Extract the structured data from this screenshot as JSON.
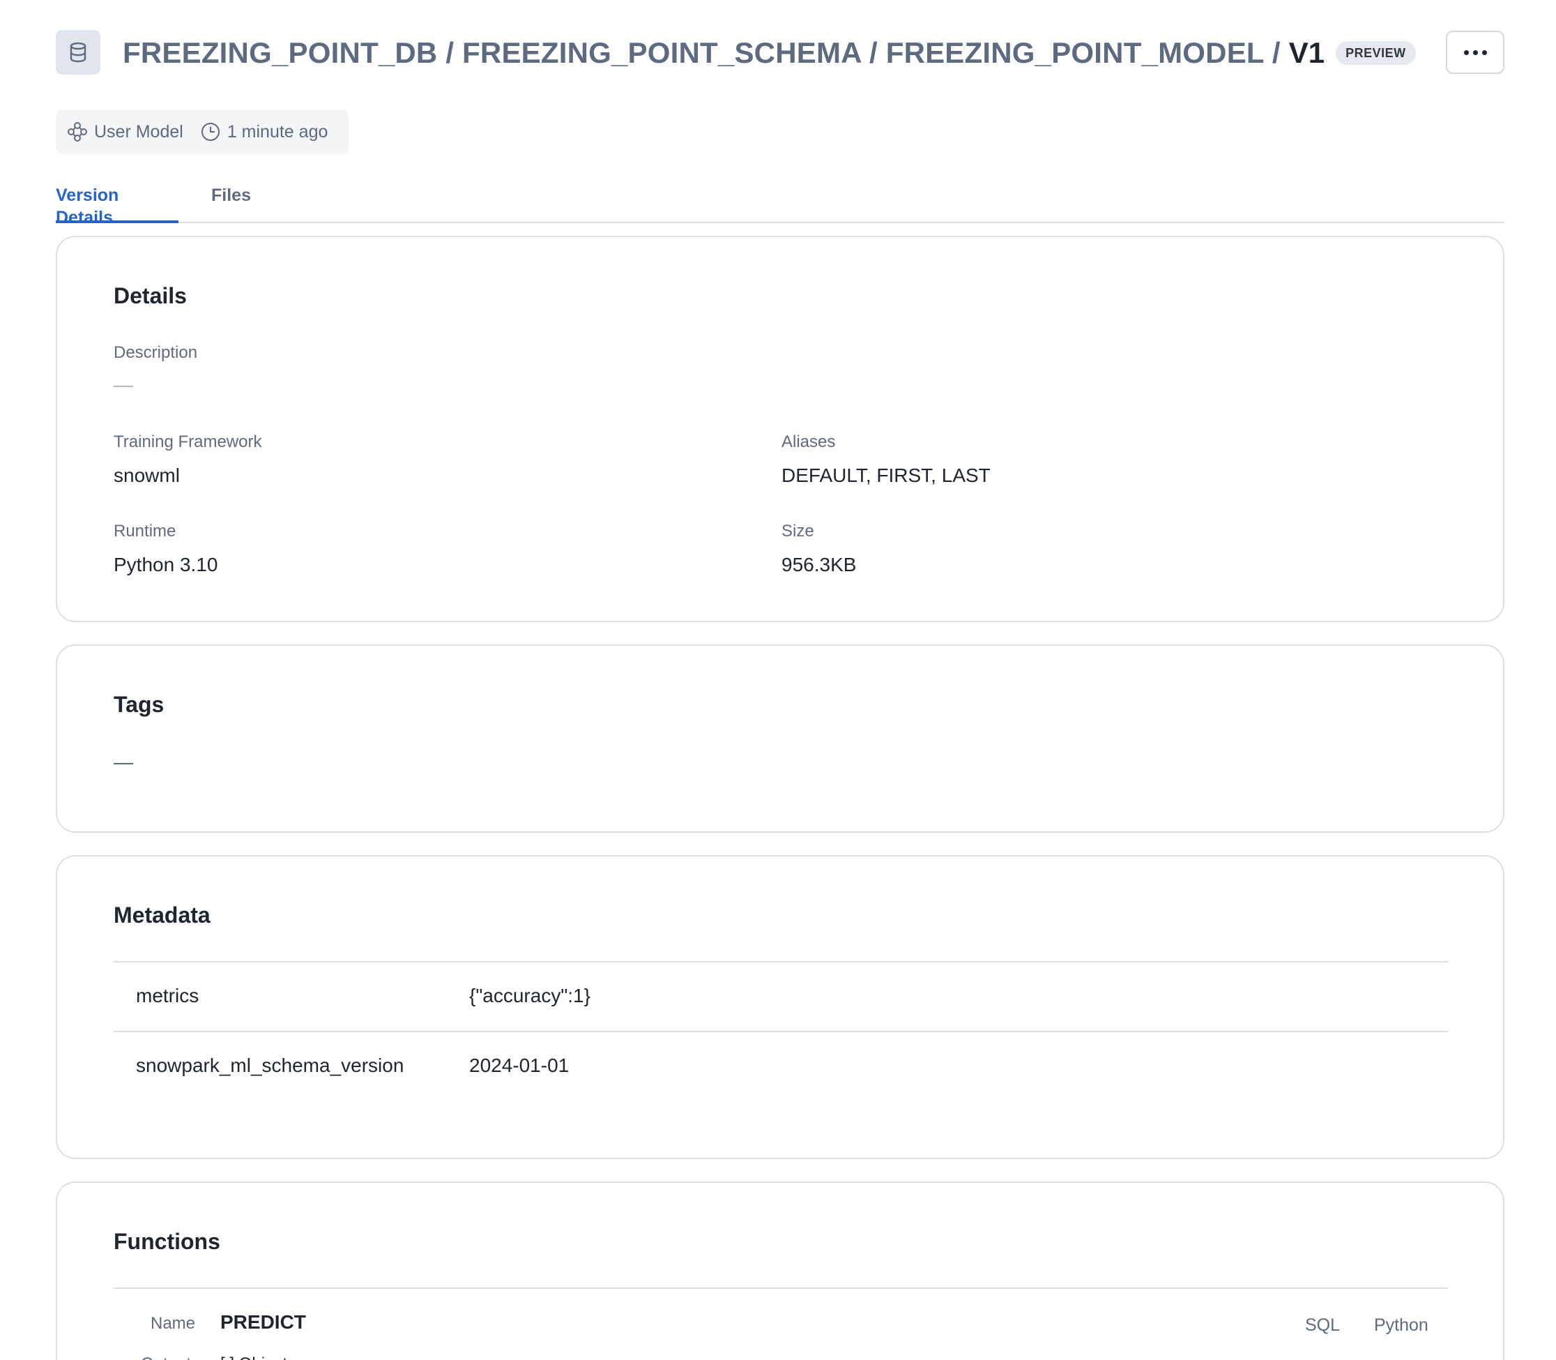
{
  "header": {
    "icon": "database-icon",
    "path": "FREEZING_POINT_DB / FREEZING_POINT_SCHEMA / FREEZING_POINT_MODEL /",
    "version": "V1",
    "badge": "PREVIEW",
    "more_icon": "more-horizontal-icon"
  },
  "meta_chip": {
    "model_type": "User Model",
    "model_type_icon": "model-graph-icon",
    "updated": "1 minute ago",
    "updated_icon": "clock-icon"
  },
  "tabs": [
    {
      "label": "Version Details",
      "active": true
    },
    {
      "label": "Files",
      "active": false
    }
  ],
  "details": {
    "title": "Details",
    "description_label": "Description",
    "description_value": "",
    "training_framework_label": "Training Framework",
    "training_framework_value": "snowml",
    "aliases_label": "Aliases",
    "aliases_value": "DEFAULT, FIRST, LAST",
    "runtime_label": "Runtime",
    "runtime_value": "Python 3.10",
    "size_label": "Size",
    "size_value": "956.3KB"
  },
  "tags": {
    "title": "Tags",
    "value": ""
  },
  "metadata": {
    "title": "Metadata",
    "rows": [
      {
        "key": "metrics",
        "value": "{\"accuracy\":1}"
      },
      {
        "key": "snowpark_ml_schema_version",
        "value": "2024-01-01"
      }
    ]
  },
  "functions": {
    "title": "Functions",
    "name_label": "Name",
    "name_value": "PREDICT",
    "output_label": "Output",
    "output_value": "[ ] Object",
    "code_tabs": [
      "SQL",
      "Python"
    ]
  },
  "colors": {
    "accent": "#2563c9",
    "muted_text": "#5d6a80",
    "border": "#dcdfe4"
  }
}
